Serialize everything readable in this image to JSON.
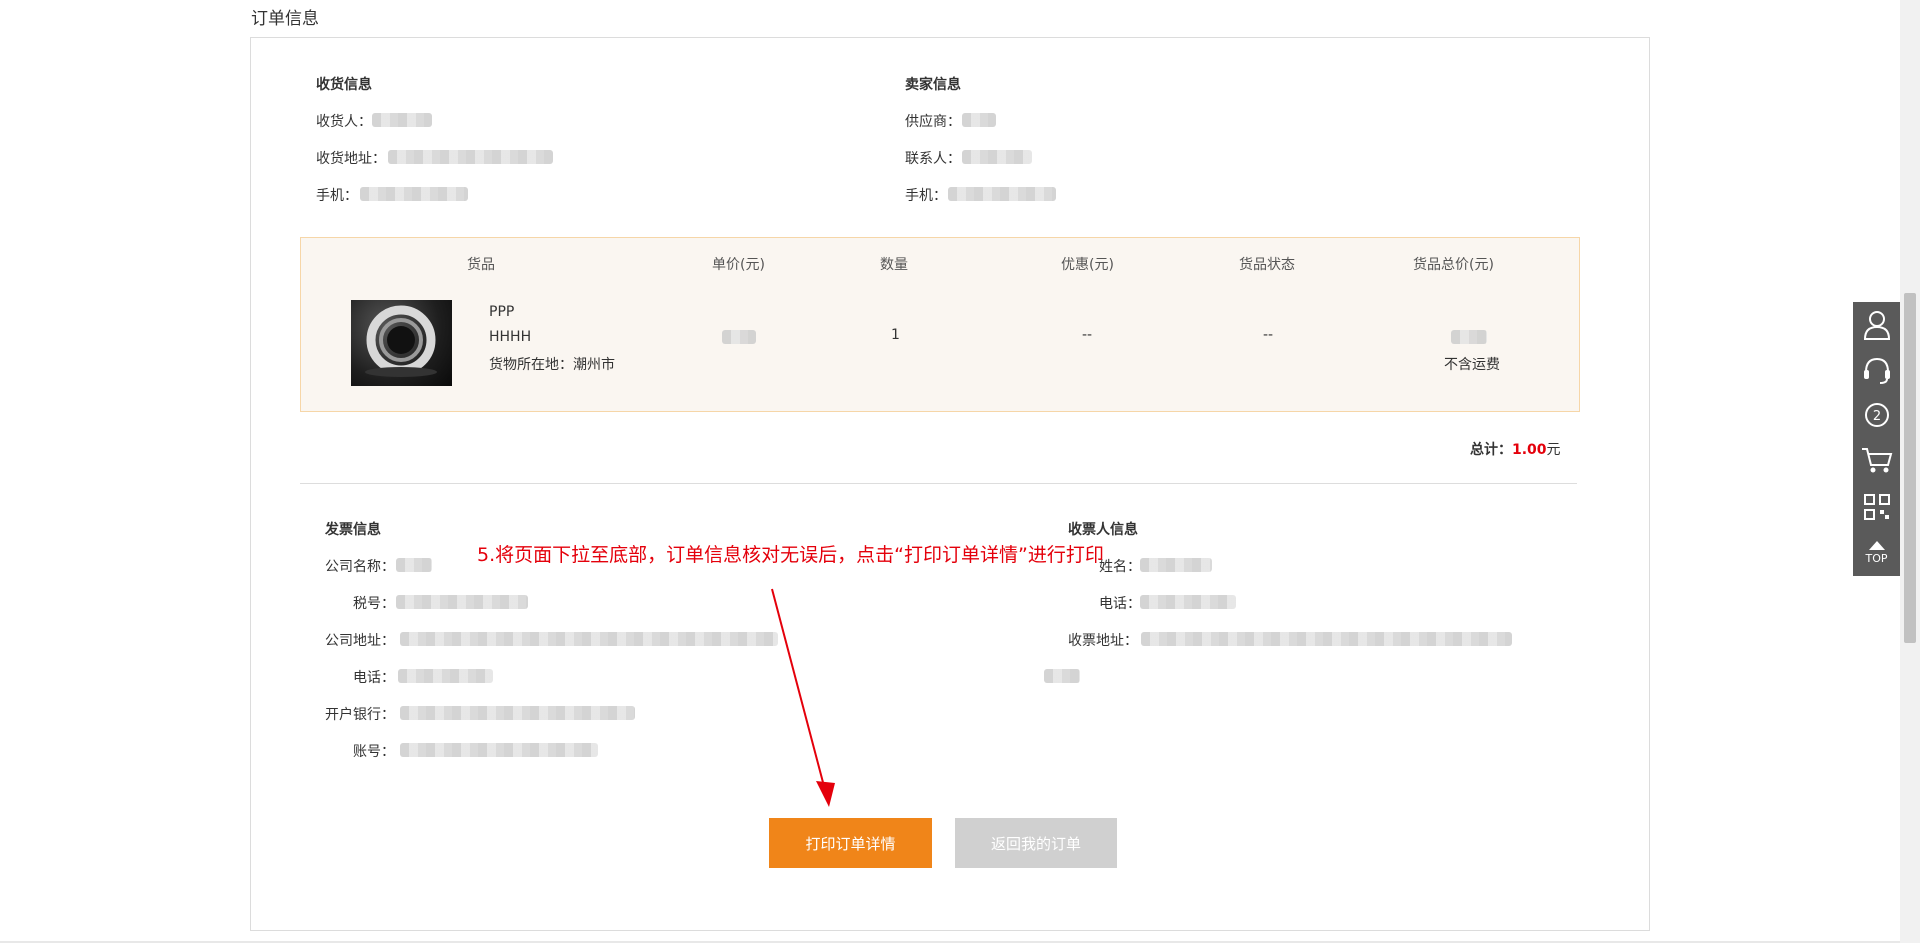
{
  "section_title": "订单信息",
  "receiver": {
    "heading": "收货信息",
    "name_label": "收货人：",
    "address_label": "收货地址：",
    "phone_label": "手机："
  },
  "seller": {
    "heading": "卖家信息",
    "supplier_label": "供应商：",
    "contact_label": "联系人：",
    "phone_label": "手机："
  },
  "goods_table": {
    "headers": [
      "货品",
      "单价(元)",
      "数量",
      "优惠(元)",
      "货品状态",
      "货品总价(元)"
    ],
    "item": {
      "name_line1": "PPP",
      "name_line2": "HHHH",
      "location": "货物所在地：潮州市",
      "quantity": "1",
      "discount": "--",
      "status": "--",
      "shipping_note": "不含运费"
    }
  },
  "total": {
    "label": "总计：",
    "value": "1.00",
    "unit": "元"
  },
  "invoice": {
    "heading": "发票信息",
    "company_label": "公司名称：",
    "tax_label": "税号：",
    "address_label": "公司地址：",
    "phone_label": "电话：",
    "bank_label": "开户银行：",
    "account_label": "账号："
  },
  "invoice_receiver": {
    "heading": "收票人信息",
    "name_label": "姓名：",
    "phone_label": "电话：",
    "address_label": "收票地址："
  },
  "annotation": "5.将页面下拉至底部，订单信息核对无误后，点击“打印订单详情”进行打印",
  "buttons": {
    "print": "打印订单详情",
    "back": "返回我的订单"
  },
  "side_toolbar": {
    "items": [
      "user-icon",
      "headset-icon",
      "badge-icon",
      "cart-icon",
      "qrcode-icon",
      "top-button"
    ],
    "badge_count": "2",
    "top_label": "TOP"
  },
  "colors": {
    "accent_orange": "#f08519",
    "total_red": "#e4000b",
    "goods_bg": "#faf6f1",
    "side_bar": "#5a5a5a"
  }
}
